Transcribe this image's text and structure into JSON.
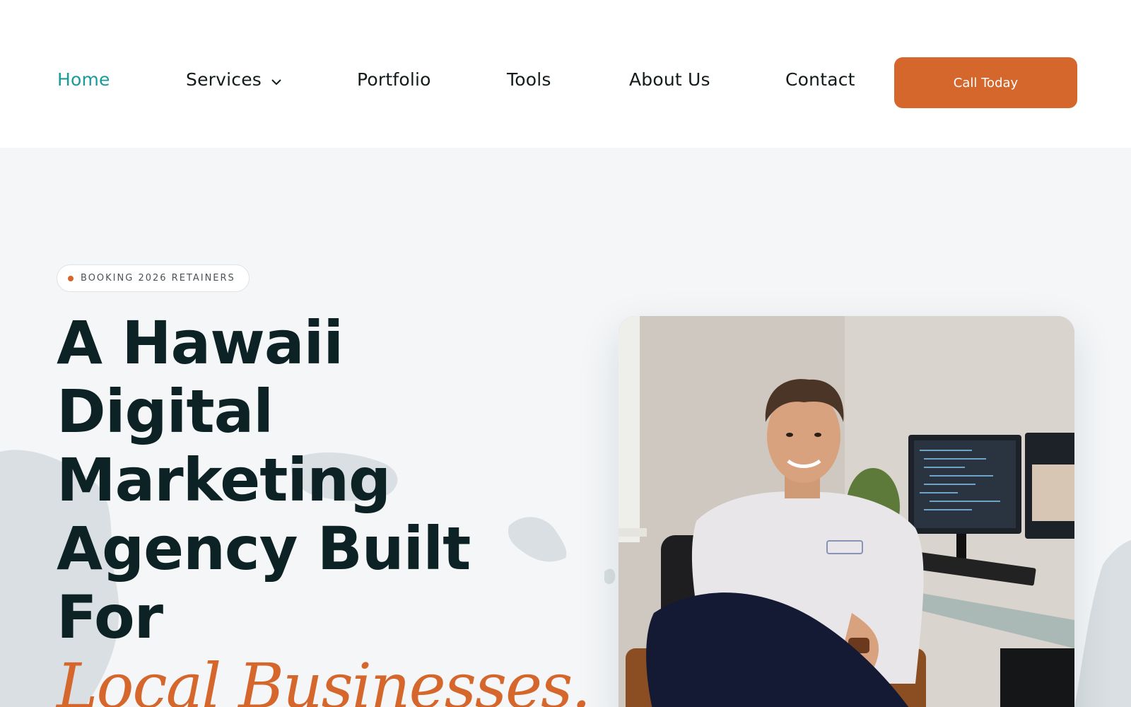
{
  "nav": {
    "items": [
      {
        "label": "Home",
        "active": true
      },
      {
        "label": "Services",
        "has_dropdown": true
      },
      {
        "label": "Portfolio"
      },
      {
        "label": "Tools"
      },
      {
        "label": "About Us"
      },
      {
        "label": "Contact"
      }
    ],
    "cta_label": "Call Today"
  },
  "hero": {
    "badge_text": "BOOKING 2026 RETAINERS",
    "headline_lines": [
      "A Hawaii",
      "Digital",
      "Marketing",
      "Agency Built",
      "For"
    ],
    "headline_accent": "Local Businesses."
  },
  "colors": {
    "accent": "#d5672d",
    "active_link": "#1b9a9a",
    "heading": "#0d2224",
    "background": "#f4f6f8"
  }
}
